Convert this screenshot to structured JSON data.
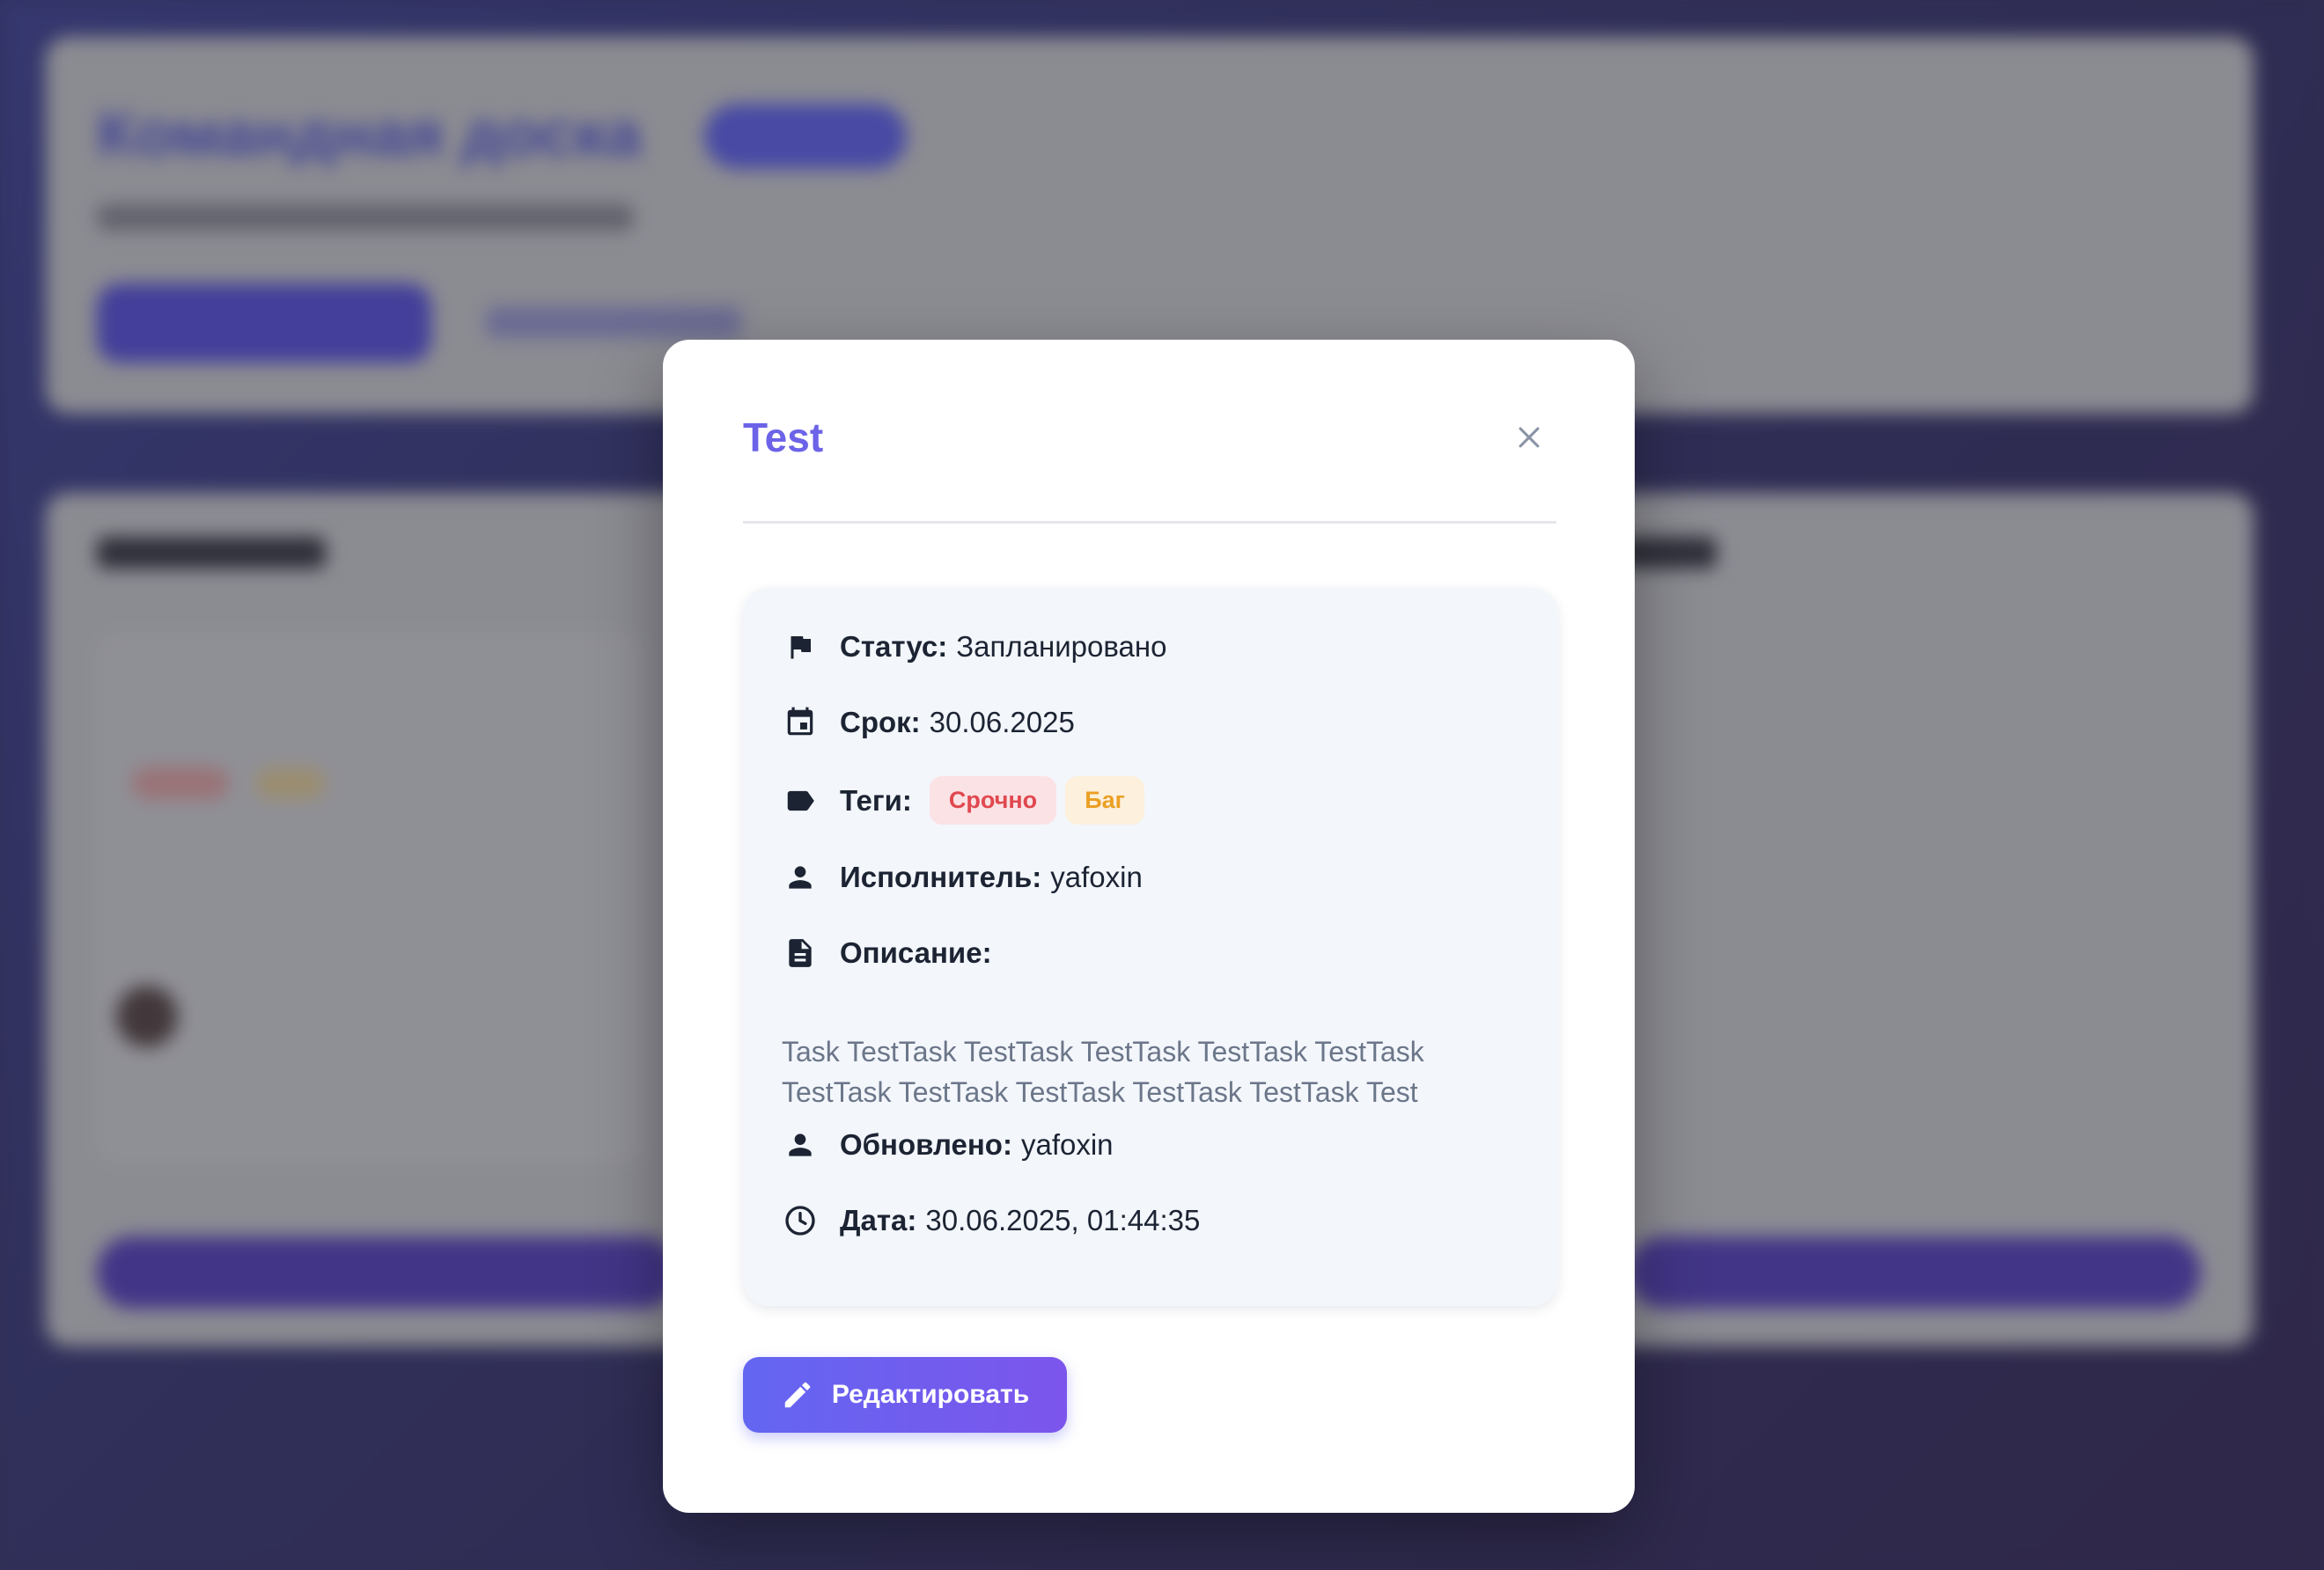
{
  "background": {
    "heading": "Командная доска"
  },
  "modal": {
    "title": "Test",
    "status_label": "Статус:",
    "status_value": "Запланировано",
    "due_label": "Срок:",
    "due_value": "30.06.2025",
    "tags_label": "Теги:",
    "tags": [
      {
        "label": "Срочно",
        "color": "#e0484f"
      },
      {
        "label": "Баг",
        "color": "#eaa024"
      }
    ],
    "assignee_label": "Исполнитель:",
    "assignee_value": "yafoxin",
    "description_label": "Описание:",
    "description_text": "Task TestTask TestTask TestTask TestTask TestTask TestTask TestTask TestTask TestTask TestTask Test",
    "updated_label": "Обновлено:",
    "updated_value": "yafoxin",
    "date_label": "Дата:",
    "date_value": "30.06.2025, 01:44:35",
    "edit_button": "Редактировать",
    "icons": {
      "close": "close-icon",
      "status": "flag-icon",
      "due": "calendar-icon",
      "tags": "tag-icon",
      "assignee": "person-icon",
      "description": "document-icon",
      "updated": "person-icon",
      "date": "clock-icon",
      "edit": "pencil-icon"
    },
    "accent_color": "#6c63e8"
  }
}
